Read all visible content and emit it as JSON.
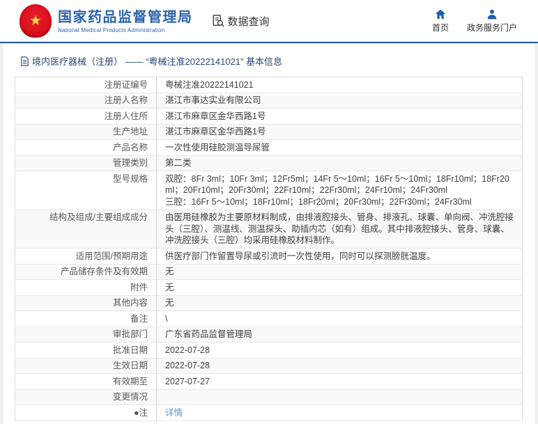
{
  "header": {
    "agency_name_cn": "国家药品监督管理局",
    "agency_name_en": "National Medical Products Administration",
    "data_query_label": "数据查询",
    "nav": [
      {
        "label": "首页"
      },
      {
        "label": "政务服务门户"
      }
    ]
  },
  "breadcrumb": {
    "text": "境内医疗器械（注册） —— “粤械注准20222141021” 基本信息"
  },
  "table": {
    "rows": [
      {
        "label": "注册证编号",
        "value": "粤械注准20222141021"
      },
      {
        "label": "注册人名称",
        "value": "湛江市事达实业有限公司"
      },
      {
        "label": "注册人住所",
        "value": "湛江市麻章区金华西路1号"
      },
      {
        "label": "生产地址",
        "value": "湛江市麻章区金华西路1号"
      },
      {
        "label": "产品名称",
        "value": "一次性使用硅胶测温导尿管"
      },
      {
        "label": "管理类别",
        "value": "第二类"
      },
      {
        "label": "型号规格",
        "value": "双腔：8Fr 3ml；10Fr 3ml；12Fr5ml；14Fr 5～10ml；16Fr 5～10ml；18Fr10ml；18Fr20ml；20Fr10ml；20Fr30ml；22Fr10ml；22Fr30ml；24Fr10ml；24Fr30ml\n三腔：16Fr 5～10ml；18Fr10ml；18Fr20ml；20Fr30ml；22Fr30ml；24Fr30ml"
      },
      {
        "label": "结构及组成/主要组成成分",
        "value": "由医用硅橡胶为主要原材料制成，由排液腔接头、管身、排液孔、球囊、单向阀、冲洗腔接头（三腔）、测温线、测温探头、助插内芯（如有）组成。其中排液腔接头、管身、球囊、冲洗腔接头（三腔）均采用硅橡胶材料制作。"
      },
      {
        "label": "适用范围/预期用途",
        "value": "供医疗部门作留置导尿或引流时一次性使用，同时可以探测膀胱温度。"
      },
      {
        "label": "产品储存条件及有效期",
        "value": "无"
      },
      {
        "label": "附件",
        "value": "无"
      },
      {
        "label": "其他内容",
        "value": "无"
      },
      {
        "label": "备注",
        "value": "\\"
      },
      {
        "label": "审批部门",
        "value": "广东省药品监督管理局"
      },
      {
        "label": "批准日期",
        "value": "2022-07-28"
      },
      {
        "label": "生效日期",
        "value": "2022-07-28"
      },
      {
        "label": "有效期至",
        "value": "2027-07-27"
      },
      {
        "label": "变更情况",
        "value": ""
      },
      {
        "label": "●注",
        "value": "详情",
        "link": true
      }
    ]
  },
  "colors": {
    "brand_blue": "#2a64ae",
    "header_border_blue": "#1c5a99",
    "emblem_red": "#d60b18",
    "link_blue": "#5b9bd5"
  }
}
